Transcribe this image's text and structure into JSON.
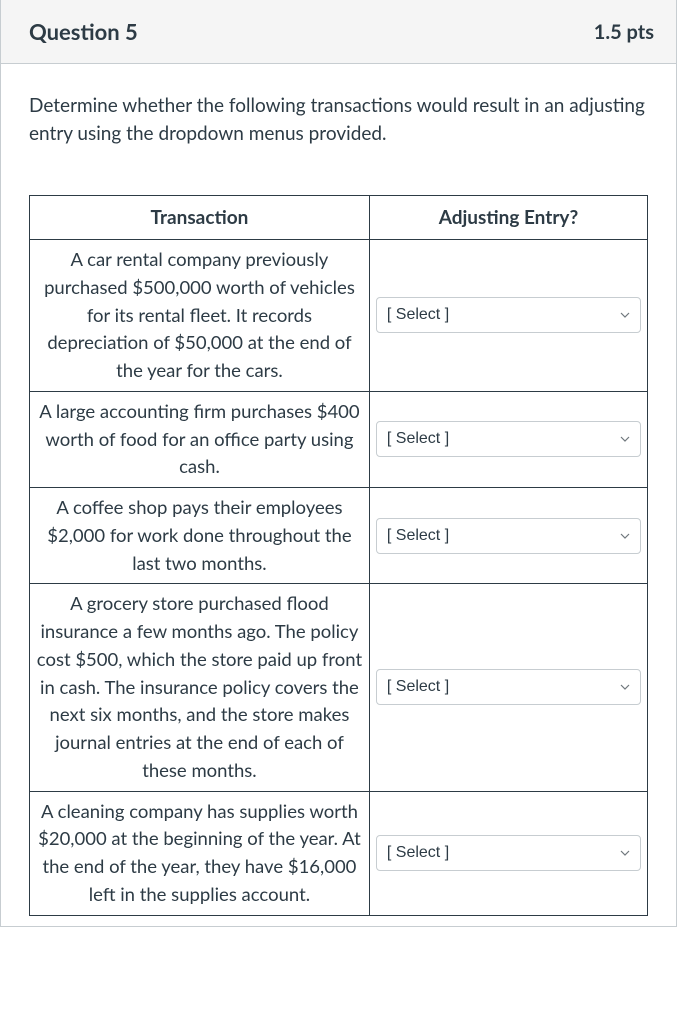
{
  "header": {
    "title": "Question 5",
    "points": "1.5 pts"
  },
  "prompt": "Determine whether the following transactions would result in an adjusting entry using the dropdown menus provided.",
  "columns": {
    "transaction": "Transaction",
    "adjusting": "Adjusting Entry?"
  },
  "select_placeholder": "[ Select ]",
  "rows": [
    {
      "transaction": "A car rental company  previously purchased $500,000 worth of vehicles for its rental fleet. It records depreciation of $50,000 at the end of the year for the cars."
    },
    {
      "transaction": "A large accounting firm purchases $400 worth of food for an office party using cash."
    },
    {
      "transaction": "A coffee shop pays their employees $2,000 for work done throughout the last two months."
    },
    {
      "transaction": "A grocery store purchased flood insurance a few months ago. The policy cost $500, which the store paid up front in cash. The insurance policy covers the next six months, and the store makes journal entries at the end of each of these months."
    },
    {
      "transaction": "A cleaning company has supplies worth $20,000 at the beginning of the year. At the end of the year, they have $16,000 left in the supplies account."
    }
  ]
}
